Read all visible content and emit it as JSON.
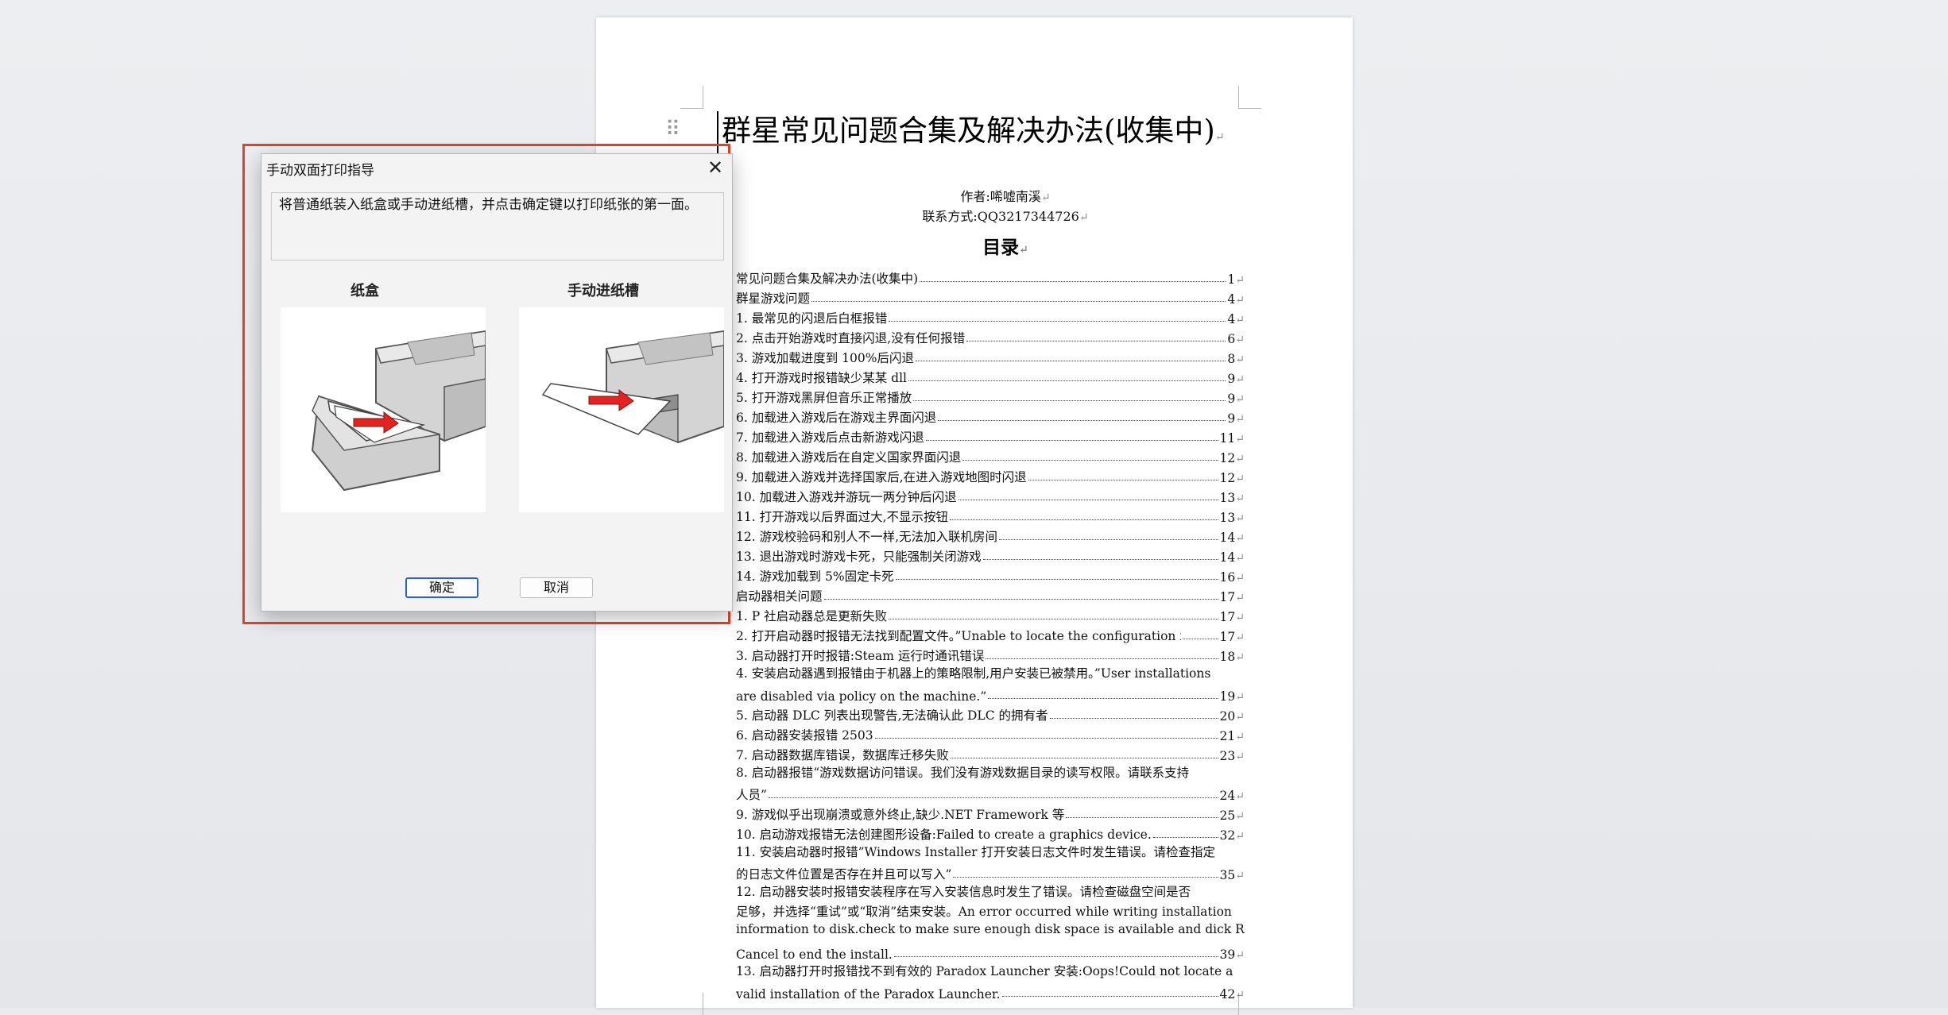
{
  "document": {
    "title": "群星常见问题合集及解决办法(收集中)",
    "author": "作者:唏嘘南溪",
    "contact": "联系方式:QQ3217344726",
    "toc_heading": "目录",
    "return_mark": "↵",
    "toc": [
      {
        "text": "常见问题合集及解决办法(收集中)",
        "page": "1"
      },
      {
        "text": "群星游戏问题",
        "page": "4"
      },
      {
        "text": "1.  最常见的闪退后白框报错",
        "page": "4"
      },
      {
        "text": "2.  点击开始游戏时直接闪退,没有任何报错",
        "page": "6"
      },
      {
        "text": "3.  游戏加载进度到 100%后闪退",
        "page": "8"
      },
      {
        "text": "4.  打开游戏时报错缺少某某 dll",
        "page": "9"
      },
      {
        "text": "5.  打开游戏黑屏但音乐正常播放",
        "page": "9"
      },
      {
        "text": "6.  加载进入游戏后在游戏主界面闪退",
        "page": "9"
      },
      {
        "text": "7.  加载进入游戏后点击新游戏闪退",
        "page": "11"
      },
      {
        "text": "8.  加载进入游戏后在自定义国家界面闪退",
        "page": "12"
      },
      {
        "text": "9.  加载进入游戏并选择国家后,在进入游戏地图时闪退",
        "page": "12"
      },
      {
        "text": "10.  加载进入游戏并游玩一两分钟后闪退",
        "page": "13"
      },
      {
        "text": "11.  打开游戏以后界面过大,不显示按钮",
        "page": "13"
      },
      {
        "text": "12.  游戏校验码和别人不一样,无法加入联机房间",
        "page": "14"
      },
      {
        "text": "13.  退出游戏时游戏卡死，只能强制关闭游戏",
        "page": "14"
      },
      {
        "text": "14.  游戏加载到 5%固定卡死",
        "page": "16"
      },
      {
        "text": "启动器相关问题",
        "page": "17"
      },
      {
        "text": "1.  P 社启动器总是更新失败",
        "page": "17"
      },
      {
        "text": "2.  打开启动器时报错无法找到配置文件。”Unable to locate the configuration file”",
        "page": "17"
      },
      {
        "text": "3.  启动器打开时报错:Steam 运行时通讯错误",
        "page": "18"
      },
      {
        "text_line1": "4. 安装启动器遇到报错由于机器上的策略限制,用户安装已被禁用。”User installations",
        "text": "are disabled via policy on the machine.”",
        "page": "19"
      },
      {
        "text": "5.  启动器 DLC 列表出现警告,无法确认此 DLC 的拥有者",
        "page": "20"
      },
      {
        "text": "6.  启动器安装报错 2503",
        "page": "21"
      },
      {
        "text": "7.  启动器数据库错误，数据库迁移失败",
        "page": "23"
      },
      {
        "text_line1": "8. 启动器报错“游戏数据访问错误。我们没有游戏数据目录的读写权限。请联系支持",
        "text": "人员”",
        "page": "24"
      },
      {
        "text": "9.  游戏似乎出现崩溃或意外终止,缺少.NET Framework 等",
        "page": "25"
      },
      {
        "text": "10.  启动游戏报错无法创建图形设备:Failed to create a graphics device.",
        "page": "32"
      },
      {
        "text_line1": "11. 安装启动器时报错”Windows Installer 打开安装日志文件时发生错误。请检查指定",
        "text": "的日志文件位置是否存在并且可以写入”",
        "page": "35"
      },
      {
        "text_line1": "12.  启动器安装时报错安装程序在写入安装信息时发生了错误。请检查磁盘空间是否",
        "text_line2": "足够，并选择“重试”或“取消”结束安装。An error occurred while writing installation",
        "text_line3": "information to disk.check to make sure enough disk space is available and dick Retry, or",
        "text": "Cancel to end the install.",
        "page": "39"
      },
      {
        "text_line1": "13.  启动器打开时报错找不到有效的 Paradox Launcher 安装:Oops!Could not locate a",
        "text": "valid installation of the Paradox Launcher.",
        "page": "42"
      }
    ]
  },
  "dialog": {
    "title": "手动双面打印指导",
    "close_glyph": "✕",
    "instruction": "将普通纸装入纸盒或手动进纸槽，并点击确定键以打印纸张的第一面。",
    "tray_label": "纸盒",
    "manual_label": "手动进纸槽",
    "ok_label": "确定",
    "cancel_label": "取消"
  },
  "colors": {
    "highlight": "#e0442e",
    "arrow": "#e32222"
  }
}
